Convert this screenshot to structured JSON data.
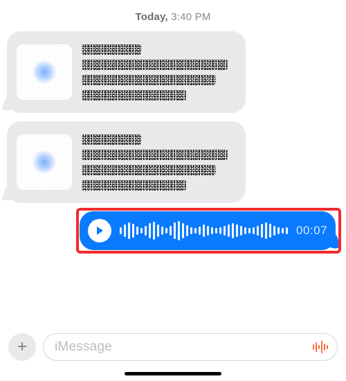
{
  "timestamp": {
    "day": "Today,",
    "time": "3:40 PM"
  },
  "audio_message": {
    "duration": "00:07",
    "waveform_heights": [
      10,
      18,
      24,
      20,
      12,
      8,
      14,
      22,
      26,
      18,
      12,
      8,
      14,
      24,
      28,
      22,
      16,
      10,
      8,
      12,
      18,
      14,
      10,
      8,
      10,
      14,
      18,
      22,
      18,
      14,
      10,
      8,
      10,
      14,
      20,
      24,
      20,
      14,
      10,
      8,
      10
    ],
    "play_icon": "play-icon"
  },
  "composer": {
    "add_label": "+",
    "placeholder": "iMessage",
    "dictate_icon": "audio-waveform-icon"
  },
  "colors": {
    "incoming_bubble": "#e9e9eb",
    "outgoing_bubble": "#0a7aff",
    "highlight_border": "#ef2b2d",
    "timestamp_text": "#8a8a8e",
    "placeholder_text": "#bdbdc2"
  }
}
